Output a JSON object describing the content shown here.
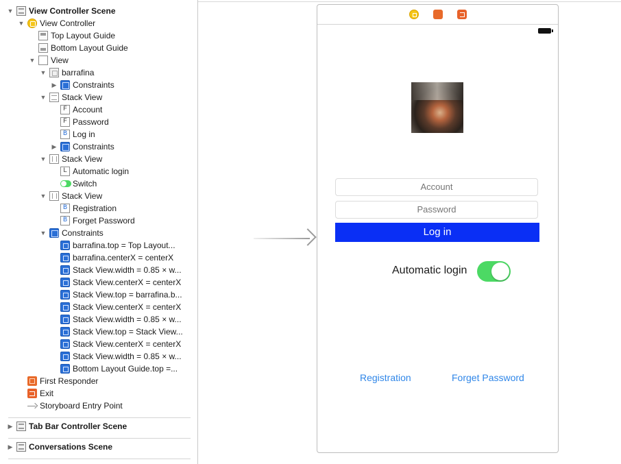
{
  "outline": {
    "items": [
      {
        "label": "View Controller Scene",
        "icon": "scene-icon",
        "disclosure": "expanded",
        "bold": true
      },
      {
        "label": "View Controller",
        "icon": "view-controller-icon",
        "disclosure": "expanded"
      },
      {
        "label": "Top Layout Guide",
        "icon": "top-layout-guide-icon"
      },
      {
        "label": "Bottom Layout Guide",
        "icon": "bottom-layout-guide-icon"
      },
      {
        "label": "View",
        "icon": "view-icon",
        "disclosure": "expanded"
      },
      {
        "label": "barrafina",
        "icon": "image-view-icon",
        "disclosure": "expanded"
      },
      {
        "label": "Constraints",
        "icon": "constraints-icon",
        "disclosure": "collapsed"
      },
      {
        "label": "Stack View",
        "icon": "vertical-stack-view-icon",
        "disclosure": "expanded"
      },
      {
        "label": "Account",
        "icon": "text-field-icon",
        "glyph": "F"
      },
      {
        "label": "Password",
        "icon": "text-field-icon",
        "glyph": "F"
      },
      {
        "label": "Log in",
        "icon": "button-icon",
        "glyph": "B"
      },
      {
        "label": "Constraints",
        "icon": "constraints-icon",
        "disclosure": "collapsed"
      },
      {
        "label": "Stack View",
        "icon": "horizontal-stack-view-icon",
        "disclosure": "expanded"
      },
      {
        "label": "Automatic login",
        "icon": "label-icon",
        "glyph": "L"
      },
      {
        "label": "Switch",
        "icon": "switch-icon"
      },
      {
        "label": "Stack View",
        "icon": "horizontal-stack-view-icon",
        "disclosure": "expanded"
      },
      {
        "label": "Registration",
        "icon": "button-icon",
        "glyph": "B"
      },
      {
        "label": "Forget Password",
        "icon": "button-icon",
        "glyph": "B"
      },
      {
        "label": "Constraints",
        "icon": "constraints-icon",
        "disclosure": "expanded"
      },
      {
        "label": "barrafina.top = Top Layout...",
        "icon": "constraint-icon"
      },
      {
        "label": "barrafina.centerX = centerX",
        "icon": "constraint-icon"
      },
      {
        "label": "Stack View.width = 0.85 × w...",
        "icon": "constraint-icon"
      },
      {
        "label": "Stack View.centerX = centerX",
        "icon": "constraint-icon"
      },
      {
        "label": "Stack View.top = barrafina.b...",
        "icon": "constraint-icon"
      },
      {
        "label": "Stack View.centerX = centerX",
        "icon": "constraint-icon"
      },
      {
        "label": "Stack View.width = 0.85 × w...",
        "icon": "constraint-icon"
      },
      {
        "label": "Stack View.top = Stack View...",
        "icon": "constraint-icon"
      },
      {
        "label": "Stack View.centerX = centerX",
        "icon": "constraint-icon"
      },
      {
        "label": "Stack View.width = 0.85 × w...",
        "icon": "constraint-icon"
      },
      {
        "label": "Bottom Layout Guide.top =...",
        "icon": "constraint-icon"
      },
      {
        "label": "First Responder",
        "icon": "first-responder-icon"
      },
      {
        "label": "Exit",
        "icon": "exit-icon"
      },
      {
        "label": "Storyboard Entry Point",
        "icon": "storyboard-entry-point-icon"
      },
      {
        "label": "Tab Bar Controller Scene",
        "icon": "scene-icon",
        "disclosure": "collapsed",
        "bold": true
      },
      {
        "label": "Conversations Scene",
        "icon": "scene-icon",
        "disclosure": "collapsed",
        "bold": true
      }
    ]
  },
  "canvas": {
    "scene_bar_icons": [
      "view-controller-icon",
      "first-responder-icon",
      "exit-icon"
    ],
    "entry_arrow_icon": "storyboard-entry-arrow-icon",
    "image_name": "barrafina",
    "account_placeholder": "Account",
    "password_placeholder": "Password",
    "login_label": "Log in",
    "automatic_login_label": "Automatic login",
    "switch_on": true,
    "registration_label": "Registration",
    "forget_password_label": "Forget Password"
  },
  "colors": {
    "login_button": "#0a2ff5",
    "switch_on": "#4cd964",
    "link": "#2f86e8",
    "view_controller_icon": "#f5c518",
    "constraint_icon": "#2a6fd6",
    "exit_icon": "#e8622a"
  }
}
